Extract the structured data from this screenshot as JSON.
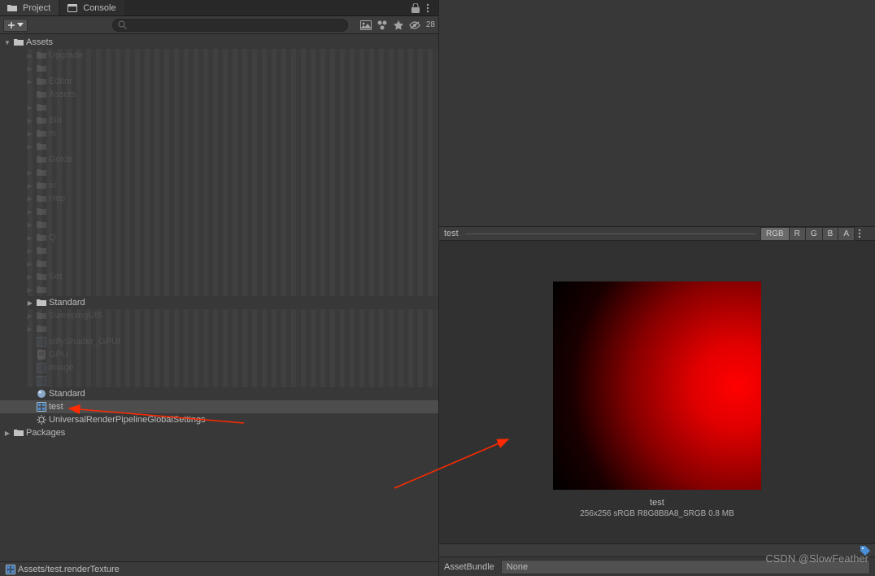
{
  "tabs": {
    "project": "Project",
    "console": "Console"
  },
  "toolbar": {
    "hidden_count": "28"
  },
  "tree": {
    "root": "Assets",
    "items": [
      {
        "label": "Upgrade",
        "type": "folder",
        "indent": 1,
        "arrow": true,
        "blur": true
      },
      {
        "label": "",
        "type": "folder",
        "indent": 1,
        "arrow": true,
        "blur": true
      },
      {
        "label": "Editor",
        "type": "folder",
        "indent": 1,
        "arrow": true,
        "blur": true
      },
      {
        "label": "Assets",
        "type": "folder",
        "indent": 1,
        "arrow": true,
        "blur": true,
        "noarrow": true
      },
      {
        "label": "",
        "type": "folder",
        "indent": 1,
        "arrow": true,
        "blur": true
      },
      {
        "label": "Blo",
        "type": "folder",
        "indent": 1,
        "arrow": true,
        "blur": true
      },
      {
        "label": "m",
        "type": "folder",
        "indent": 1,
        "arrow": true,
        "blur": true
      },
      {
        "label": "",
        "type": "folder",
        "indent": 1,
        "arrow": true,
        "blur": true
      },
      {
        "label": "Golde",
        "type": "folder",
        "indent": 1,
        "arrow": false,
        "blur": true,
        "noarrow": true
      },
      {
        "label": "",
        "type": "folder",
        "indent": 1,
        "arrow": true,
        "blur": true
      },
      {
        "label": "er",
        "type": "folder",
        "indent": 1,
        "arrow": true,
        "blur": true
      },
      {
        "label": "Hep",
        "type": "folder",
        "indent": 1,
        "arrow": true,
        "blur": true
      },
      {
        "label": "",
        "type": "folder",
        "indent": 1,
        "arrow": true,
        "blur": true
      },
      {
        "label": "",
        "type": "folder",
        "indent": 1,
        "arrow": true,
        "blur": true
      },
      {
        "label": "Q",
        "type": "folder",
        "indent": 1,
        "arrow": true,
        "blur": true
      },
      {
        "label": "",
        "type": "folder",
        "indent": 1,
        "arrow": true,
        "blur": true
      },
      {
        "label": "",
        "type": "folder",
        "indent": 1,
        "arrow": true,
        "blur": true
      },
      {
        "label": "Set",
        "type": "folder",
        "indent": 1,
        "arrow": true,
        "blur": true
      },
      {
        "label": "",
        "type": "folder",
        "indent": 1,
        "arrow": true,
        "blur": true
      },
      {
        "label": "Standard",
        "type": "folder",
        "indent": 1,
        "arrow": true
      },
      {
        "label": "SweepingUIS",
        "type": "folder",
        "indent": 1,
        "arrow": true,
        "blur": true
      },
      {
        "label": "",
        "type": "folder",
        "indent": 1,
        "arrow": true,
        "blur": true
      },
      {
        "label": "olifyShader_GPUI",
        "type": "asset",
        "indent": 1,
        "blur": true,
        "noarrow": true
      },
      {
        "label": "GPU",
        "type": "script",
        "indent": 1,
        "blur": true,
        "noarrow": true
      },
      {
        "label": "Image",
        "type": "asset",
        "indent": 1,
        "blur": true,
        "noarrow": true
      },
      {
        "label": "",
        "type": "asset",
        "indent": 1,
        "blur": true,
        "noarrow": true
      },
      {
        "label": "Standard",
        "type": "material",
        "indent": 1,
        "noarrow": true
      },
      {
        "label": "test",
        "type": "rendertexture",
        "indent": 1,
        "selected": true,
        "noarrow": true
      },
      {
        "label": "UniversalRenderPipelineGlobalSettings",
        "type": "settings",
        "indent": 1,
        "noarrow": true
      }
    ],
    "packages": "Packages"
  },
  "statusbar": {
    "path": "Assets/test.renderTexture"
  },
  "preview": {
    "title": "test",
    "channels": [
      "RGB",
      "R",
      "G",
      "B",
      "A"
    ],
    "active_channel": "RGB",
    "texture_name": "test",
    "texture_info": "256x256 sRGB  R8G8B8A8_SRGB  0.8 MB"
  },
  "assetbundle": {
    "label": "AssetBundle",
    "value": "None"
  },
  "watermark": "CSDN @SlowFeather"
}
